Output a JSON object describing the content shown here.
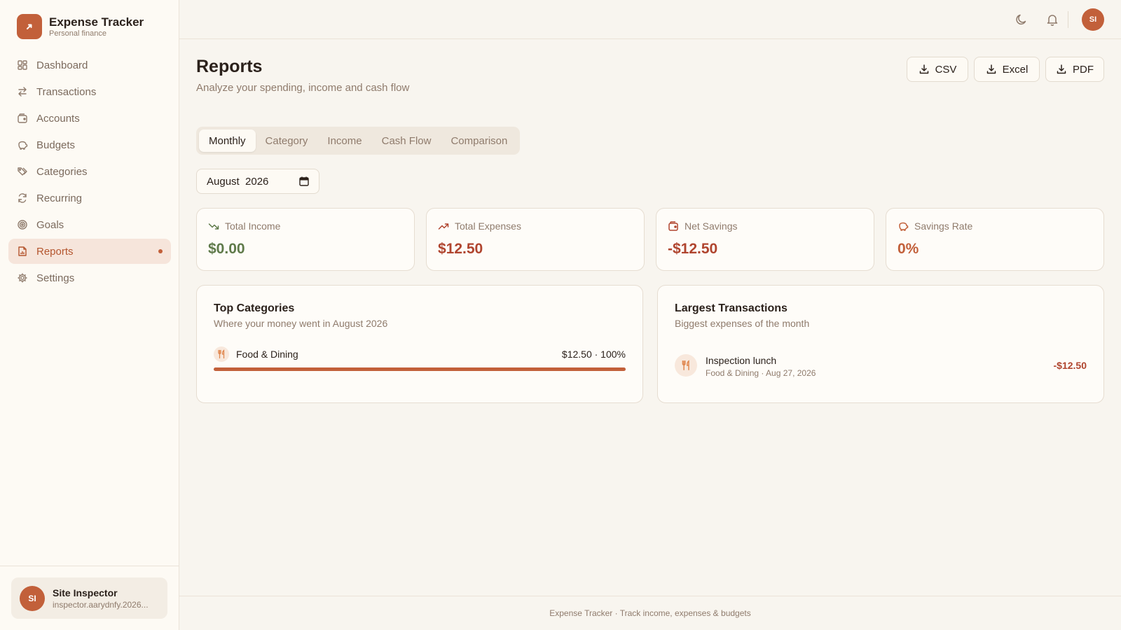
{
  "app": {
    "title": "Expense Tracker",
    "subtitle": "Personal finance"
  },
  "sidebar": {
    "items": [
      {
        "label": "Dashboard",
        "icon": "grid-icon"
      },
      {
        "label": "Transactions",
        "icon": "arrows-icon"
      },
      {
        "label": "Accounts",
        "icon": "wallet-icon"
      },
      {
        "label": "Budgets",
        "icon": "piggy-bank-icon"
      },
      {
        "label": "Categories",
        "icon": "tags-icon"
      },
      {
        "label": "Recurring",
        "icon": "refresh-icon"
      },
      {
        "label": "Goals",
        "icon": "target-icon"
      },
      {
        "label": "Reports",
        "icon": "file-chart-icon",
        "active": true
      },
      {
        "label": "Settings",
        "icon": "gear-icon"
      }
    ]
  },
  "user": {
    "initials": "SI",
    "name": "Site Inspector",
    "email": "inspector.aarydnfy.2026..."
  },
  "page": {
    "title": "Reports",
    "subtitle": "Analyze your spending, income and cash flow"
  },
  "exports": {
    "csv": "CSV",
    "excel": "Excel",
    "pdf": "PDF"
  },
  "tabs": [
    "Monthly",
    "Category",
    "Income",
    "Cash Flow",
    "Comparison"
  ],
  "month_picker": {
    "value": "August  2026"
  },
  "stats": {
    "income": {
      "label": "Total Income",
      "value": "$0.00",
      "color": "#5f7a4a"
    },
    "expenses": {
      "label": "Total Expenses",
      "value": "$12.50",
      "color": "#b0452f"
    },
    "net": {
      "label": "Net Savings",
      "value": "-$12.50",
      "color": "#b0452f"
    },
    "rate": {
      "label": "Savings Rate",
      "value": "0%",
      "color": "#c2603a"
    }
  },
  "top_categories": {
    "title": "Top Categories",
    "subtitle": "Where your money went in August 2026",
    "items": [
      {
        "name": "Food & Dining",
        "amount": "$12.50 · 100%",
        "share": 1.0
      }
    ]
  },
  "largest_transactions": {
    "title": "Largest Transactions",
    "subtitle": "Biggest expenses of the month",
    "items": [
      {
        "name": "Inspection lunch",
        "meta": "Food & Dining · Aug 27, 2026",
        "amount": "-$12.50"
      }
    ]
  },
  "footer": {
    "text": "Expense Tracker · Track income, expenses & budgets"
  },
  "colors": {
    "accent": "#c2603a",
    "positive": "#5f7a4a",
    "negative": "#b0452f"
  }
}
